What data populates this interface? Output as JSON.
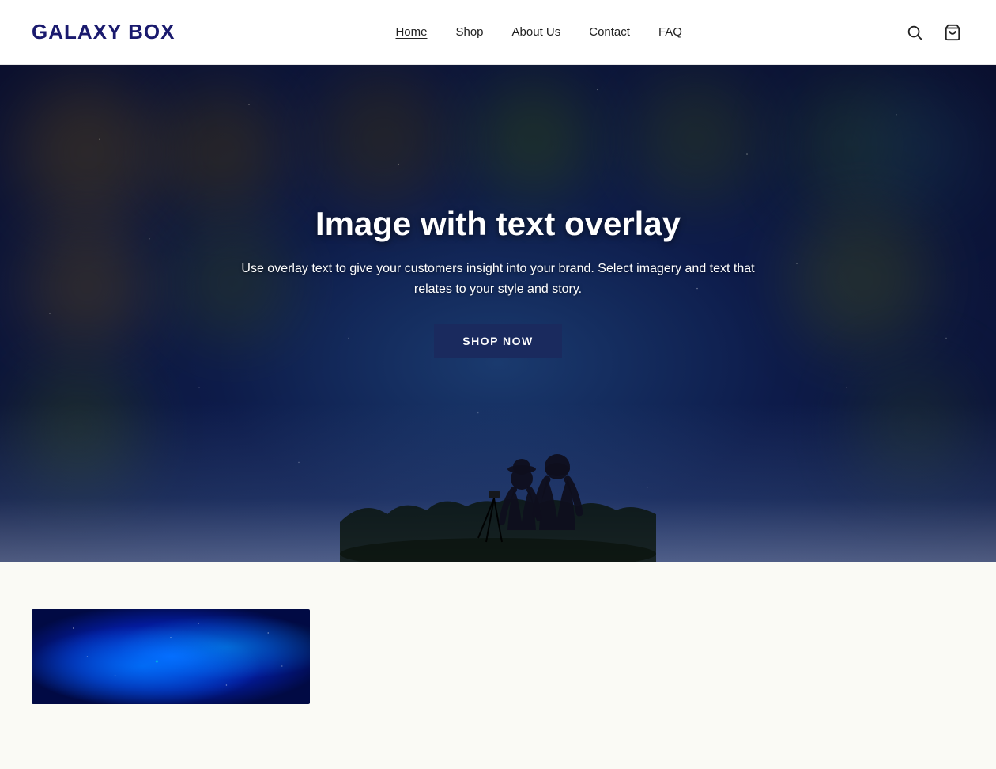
{
  "header": {
    "logo_text": "GALAXY BOX",
    "nav_items": [
      {
        "label": "Home",
        "active": true
      },
      {
        "label": "Shop",
        "active": false
      },
      {
        "label": "About Us",
        "active": false
      },
      {
        "label": "Contact",
        "active": false
      },
      {
        "label": "FAQ",
        "active": false
      }
    ]
  },
  "hero": {
    "title": "Image with text overlay",
    "subtitle": "Use overlay text to give your customers insight into your brand. Select imagery and text that relates to your style and story.",
    "cta_label": "SHOP NOW"
  },
  "below_hero": {
    "product_section_visible": true
  }
}
